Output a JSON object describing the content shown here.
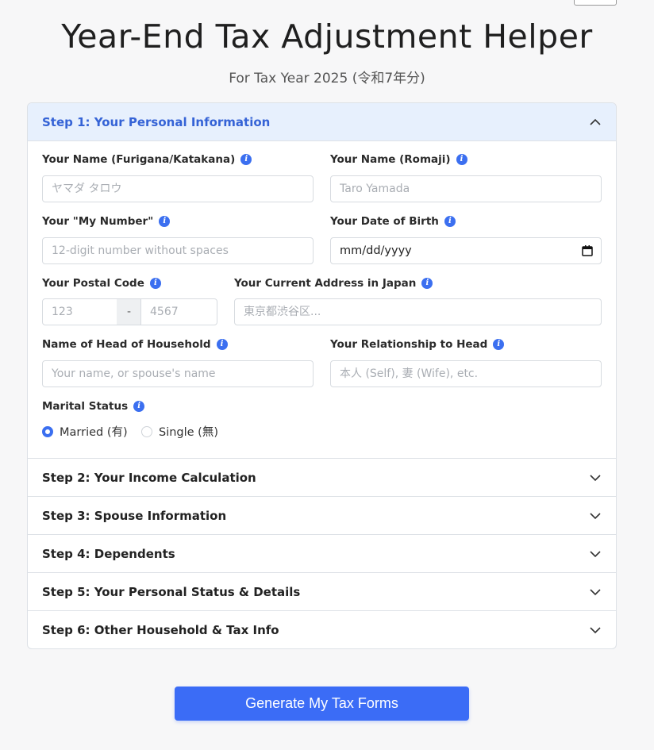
{
  "header": {
    "title": "Year-End Tax Adjustment Helper",
    "subtitle": "For Tax Year 2025 (令和7年分)"
  },
  "steps": [
    {
      "label": "Step 1: Your Personal Information",
      "open": true
    },
    {
      "label": "Step 2: Your Income Calculation",
      "open": false
    },
    {
      "label": "Step 3: Spouse Information",
      "open": false
    },
    {
      "label": "Step 4: Dependents",
      "open": false
    },
    {
      "label": "Step 5: Your Personal Status & Details",
      "open": false
    },
    {
      "label": "Step 6: Other Household & Tax Info",
      "open": false
    }
  ],
  "form": {
    "name_furigana": {
      "label": "Your Name (Furigana/Katakana)",
      "placeholder": "ヤマダ タロウ",
      "value": ""
    },
    "name_romaji": {
      "label": "Your Name (Romaji)",
      "placeholder": "Taro Yamada",
      "value": ""
    },
    "my_number": {
      "label": "Your \"My Number\"",
      "placeholder": "12-digit number without spaces",
      "value": ""
    },
    "dob": {
      "label": "Your Date of Birth",
      "value": "mm/dd/yyyy"
    },
    "postal": {
      "label": "Your Postal Code",
      "placeholder_1": "123",
      "separator": "-",
      "placeholder_2": "4567"
    },
    "address": {
      "label": "Your Current Address in Japan",
      "placeholder": "東京都渋谷区..."
    },
    "head": {
      "label": "Name of Head of Household",
      "placeholder": "Your name, or spouse's name"
    },
    "relationship": {
      "label": "Your Relationship to Head",
      "placeholder": "本人 (Self), 妻 (Wife), etc."
    },
    "marital": {
      "label": "Marital Status",
      "options": [
        {
          "label": "Married (有)",
          "checked": true
        },
        {
          "label": "Single (無)",
          "checked": false
        }
      ]
    }
  },
  "submit_label": "Generate My Tax Forms",
  "info_icon_glyph": "i",
  "colors": {
    "accent": "#3b6ff0",
    "open_header_bg": "#e7f0fd",
    "open_header_text": "#3563d6"
  }
}
